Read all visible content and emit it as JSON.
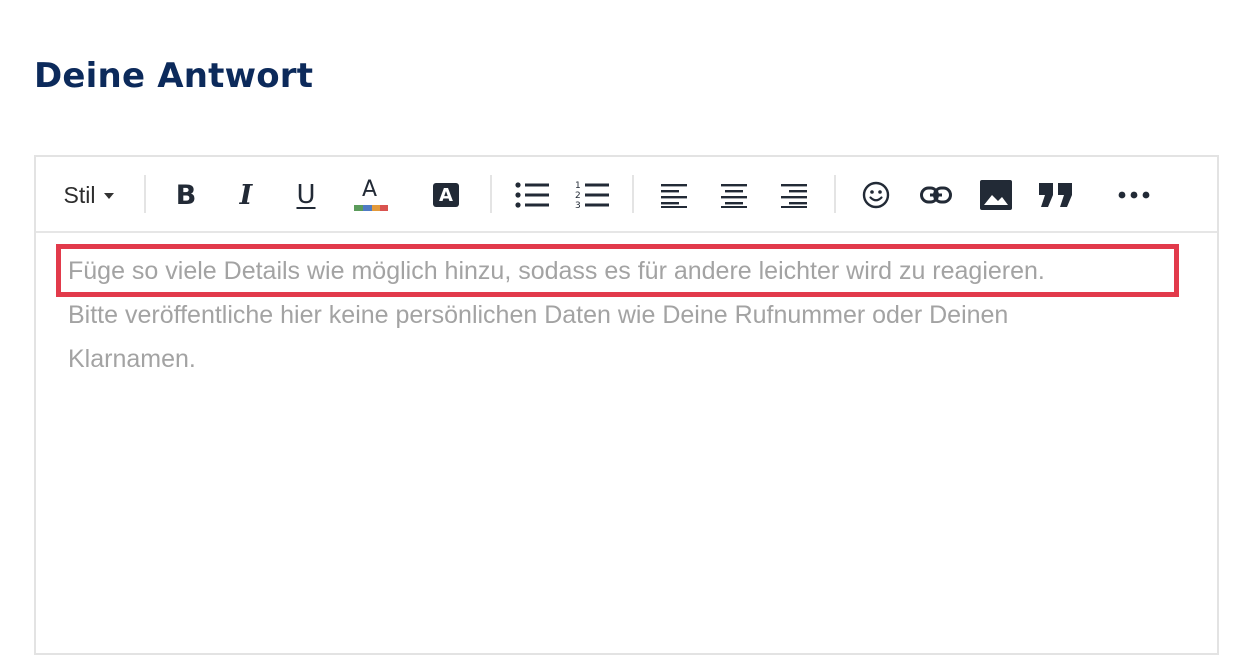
{
  "heading": "Deine Antwort",
  "toolbar": {
    "style_label": "Stil",
    "buttons": [
      {
        "name": "bold",
        "icon": "bold-icon",
        "glyph": "B"
      },
      {
        "name": "italic",
        "icon": "italic-icon",
        "glyph": "I"
      },
      {
        "name": "underline",
        "icon": "underline-icon",
        "glyph": "U"
      },
      {
        "name": "font-color",
        "icon": "font-color-icon",
        "glyph": "A"
      },
      {
        "name": "highlight",
        "icon": "background-color-icon",
        "glyph": "A"
      },
      {
        "name": "bulleted-list",
        "icon": "bulleted-list-icon"
      },
      {
        "name": "numbered-list",
        "icon": "numbered-list-icon"
      },
      {
        "name": "align-left",
        "icon": "align-left-icon"
      },
      {
        "name": "align-center",
        "icon": "align-center-icon"
      },
      {
        "name": "align-right",
        "icon": "align-right-icon"
      },
      {
        "name": "emoji",
        "icon": "emoji-icon"
      },
      {
        "name": "link",
        "icon": "link-icon"
      },
      {
        "name": "image",
        "icon": "image-icon"
      },
      {
        "name": "quote",
        "icon": "quote-icon"
      },
      {
        "name": "more",
        "icon": "more-icon"
      }
    ]
  },
  "editor": {
    "placeholder_lines": [
      "Füge so viele Details wie möglich hinzu, sodass es für andere leichter wird zu reagieren.",
      "Bitte veröffentliche hier keine persönlichen Daten wie Deine Rufnummer oder Deinen",
      "Klarnamen."
    ]
  },
  "colors": {
    "heading": "#0c2a5b",
    "placeholder": "#a3a3a3",
    "highlight_box": "#e23a4b",
    "icon": "#222a36"
  }
}
